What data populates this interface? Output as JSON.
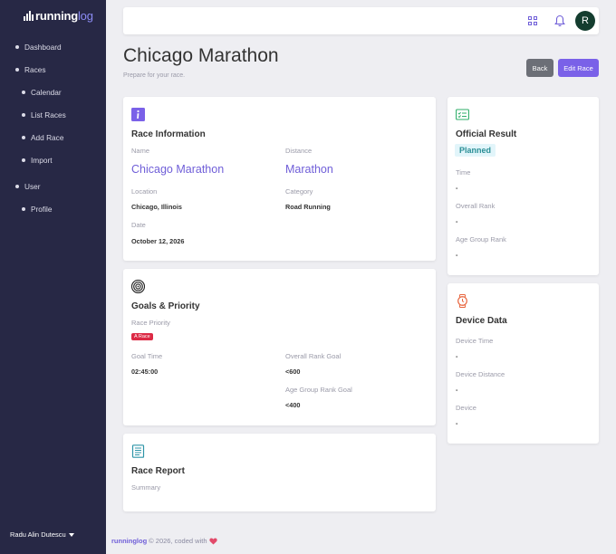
{
  "brand": {
    "running": "running",
    "log": "log"
  },
  "nav": {
    "dashboard": "Dashboard",
    "races": "Races",
    "calendar": "Calendar",
    "list_races": "List Races",
    "add_race": "Add Race",
    "import": "Import",
    "user": "User",
    "profile": "Profile"
  },
  "sidebar_user": "Radu Alin Dutescu",
  "topbar": {
    "avatar_initial": "R"
  },
  "header": {
    "title": "Chicago Marathon",
    "subtitle": "Prepare for your race.",
    "back_label": "Back",
    "edit_label": "Edit Race"
  },
  "race_info": {
    "title": "Race Information",
    "name_label": "Name",
    "name": "Chicago Marathon",
    "distance_label": "Distance",
    "distance": "Marathon",
    "location_label": "Location",
    "location": "Chicago, Illinois",
    "category_label": "Category",
    "category": "Road Running",
    "date_label": "Date",
    "date": "October 12, 2026"
  },
  "goals": {
    "title": "Goals & Priority",
    "priority_label": "Race Priority",
    "priority": "A Race",
    "goal_time_label": "Goal Time",
    "goal_time": "02:45:00",
    "overall_rank_goal_label": "Overall Rank Goal",
    "overall_rank_goal": "<600",
    "age_group_rank_goal_label": "Age Group Rank Goal",
    "age_group_rank_goal": "<400"
  },
  "race_report": {
    "title": "Race Report",
    "summary_label": "Summary"
  },
  "official_result": {
    "title": "Official Result",
    "status": "Planned",
    "time_label": "Time",
    "time": "-",
    "overall_rank_label": "Overall Rank",
    "overall_rank": "-",
    "age_group_rank_label": "Age Group Rank",
    "age_group_rank": "-"
  },
  "device_data": {
    "title": "Device Data",
    "device_time_label": "Device Time",
    "device_time": "-",
    "device_distance_label": "Device Distance",
    "device_distance": "-",
    "device_label": "Device",
    "device": "-"
  },
  "footer": {
    "brand_running": "running",
    "brand_log": "log",
    "text": "© 2026, coded with"
  },
  "colors": {
    "sidebar_bg": "#272845",
    "accent": "#7a61e8",
    "danger": "#dc2a45",
    "info_bg": "#e2f5fa",
    "success_icon": "#2fae6a"
  }
}
